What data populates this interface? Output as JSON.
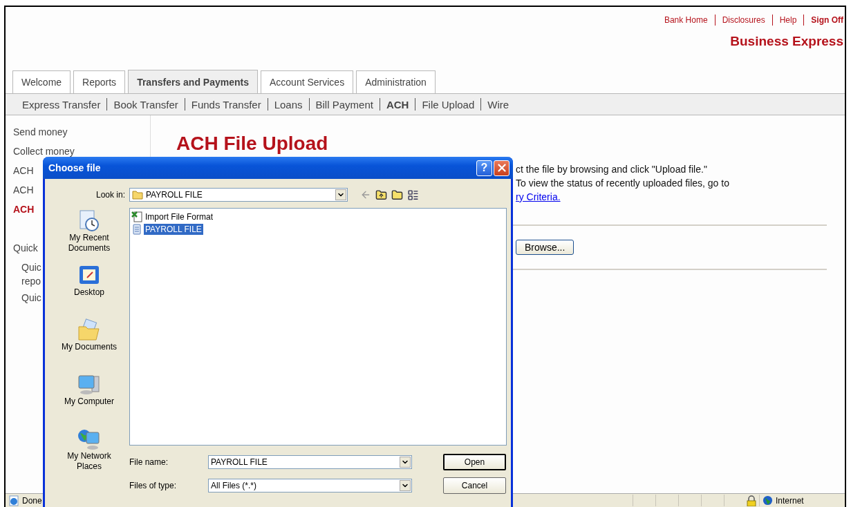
{
  "header_links": [
    {
      "label": "Bank Home",
      "kind": "link"
    },
    {
      "label": "Disclosures",
      "kind": "link"
    },
    {
      "label": "Help",
      "kind": "link"
    },
    {
      "label": "Sign Off",
      "kind": "signoff"
    }
  ],
  "brand": "Business Express",
  "tabs": [
    {
      "label": "Welcome",
      "selected": false
    },
    {
      "label": "Reports",
      "selected": false
    },
    {
      "label": "Transfers and Payments",
      "selected": true
    },
    {
      "label": "Account Services",
      "selected": false
    },
    {
      "label": "Administration",
      "selected": false
    }
  ],
  "subnav": [
    {
      "label": "Express Transfer",
      "selected": false
    },
    {
      "label": "Book Transfer",
      "selected": false
    },
    {
      "label": "Funds Transfer",
      "selected": false
    },
    {
      "label": "Loans",
      "selected": false
    },
    {
      "label": "Bill Payment",
      "selected": false
    },
    {
      "label": "ACH",
      "selected": true
    },
    {
      "label": "File Upload",
      "selected": false
    },
    {
      "label": "Wire",
      "selected": false
    }
  ],
  "sidebar": {
    "items": [
      {
        "label": "Send money",
        "selected": false
      },
      {
        "label": "Collect money",
        "selected": false
      },
      {
        "label": "ACH",
        "selected": false
      },
      {
        "label": "ACH",
        "selected": false
      },
      {
        "label": "ACH",
        "selected": true
      }
    ],
    "quick_heading": "Quick",
    "quick_items": [
      {
        "lines": [
          "Quic",
          "repo"
        ]
      },
      {
        "lines": [
          "Quic"
        ]
      }
    ]
  },
  "page": {
    "title": "ACH File Upload",
    "instruction_lines": [
      "ct the file by browsing and click \"Upload file.\"",
      "To view the status of recently uploaded files, go to"
    ],
    "link": "ry Criteria.",
    "browse_button": "Browse..."
  },
  "dialog": {
    "title": "Choose file",
    "help_button": "?",
    "look_in_label": "Look in:",
    "look_in_value": "PAYROLL FILE",
    "places": [
      {
        "label": "My Recent Documents",
        "kind": "recent"
      },
      {
        "label": "Desktop",
        "kind": "desktop"
      },
      {
        "label": "My Documents",
        "kind": "documents"
      },
      {
        "label": "My Computer",
        "kind": "computer"
      },
      {
        "label": "My Network Places",
        "kind": "network"
      }
    ],
    "files": [
      {
        "name": "Import File Format",
        "kind": "spreadsheet",
        "selected": false
      },
      {
        "name": "PAYROLL FILE",
        "kind": "text",
        "selected": true
      }
    ],
    "file_name_label": "File name:",
    "file_name_value": "PAYROLL FILE",
    "file_type_label": "Files of type:",
    "file_type_value": "All Files (*.*)",
    "open_button": "Open",
    "cancel_button": "Cancel"
  },
  "status_bar": {
    "text": "Done",
    "zone": "Internet"
  }
}
